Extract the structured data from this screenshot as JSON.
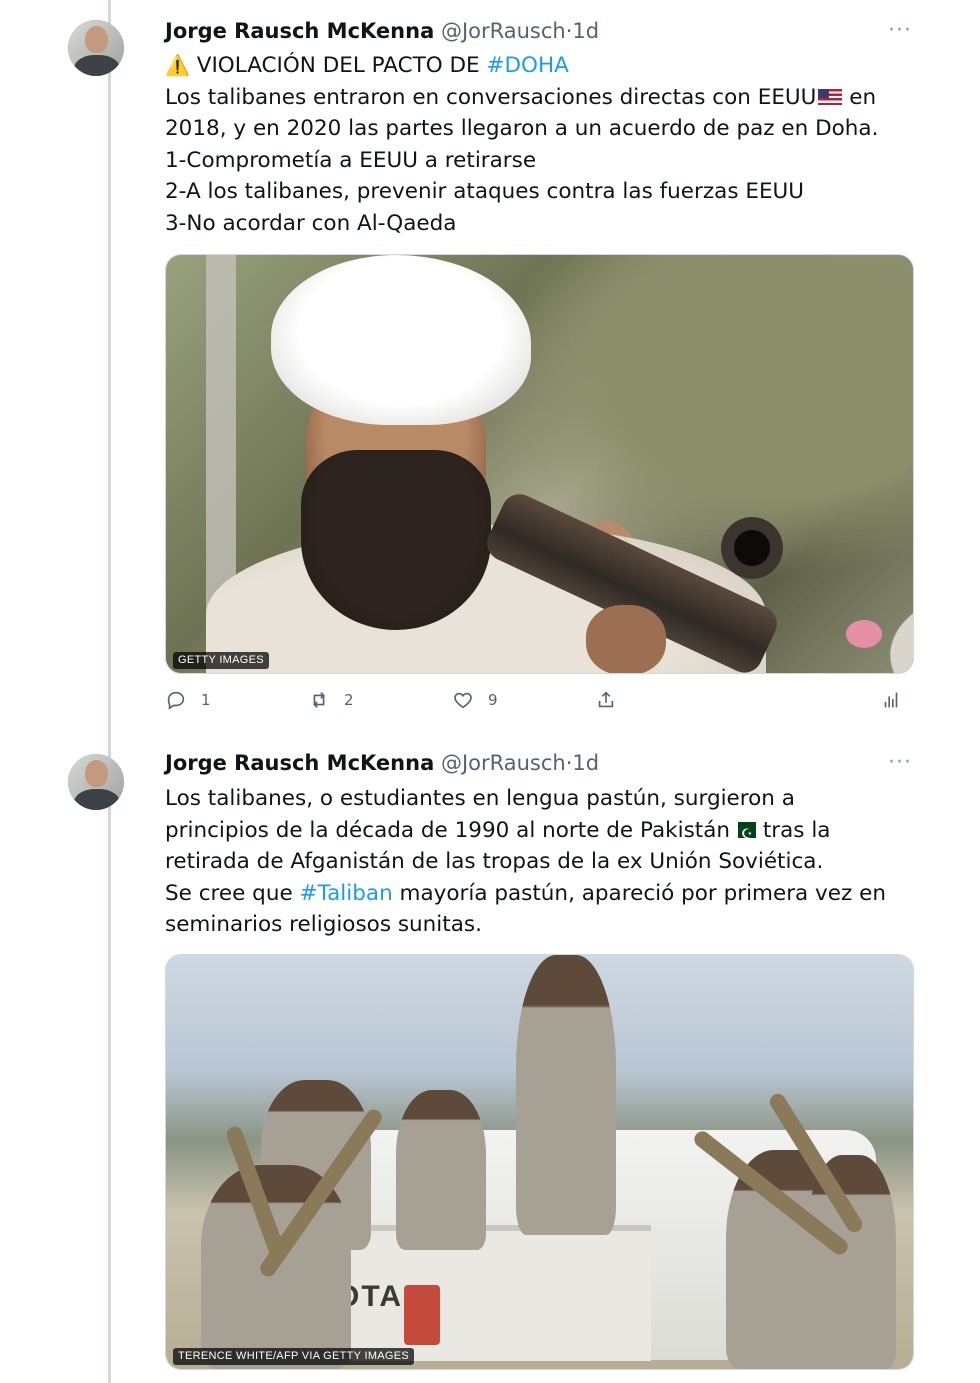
{
  "tweets": [
    {
      "author_name": "Jorge Rausch McKenna",
      "handle": "@JorRausch",
      "separator": "·",
      "time": "1d",
      "more_icon": "more-horizontal-icon",
      "lines": {
        "warning_emoji": "⚠️",
        "headline_text": "VIOLACIÓN DEL PACTO DE ",
        "headline_hashtag": "#DOHA",
        "l2a": "Los talibanes entraron en conversaciones directas con EEUU",
        "l2b": " en",
        "l3": "2018, y en 2020 las partes llegaron a un acuerdo de paz en Doha.",
        "l4": "1-Comprometía a EEUU a retirarse",
        "l5": "2-A los talibanes, prevenir ataques contra las fuerzas EEUU",
        "l6": "3-No acordar con Al-Qaeda"
      },
      "media_credit": "GETTY IMAGES",
      "stats": {
        "replies": "1",
        "retweets": "2",
        "likes": "9"
      }
    },
    {
      "author_name": "Jorge Rausch McKenna",
      "handle": "@JorRausch",
      "separator": "·",
      "time": "1d",
      "more_icon": "more-horizontal-icon",
      "lines": {
        "l1": "Los talibanes, o estudiantes en lengua pastún, surgieron a",
        "l2a": "principios de la década de 1990 al norte de Pakistán",
        "l2b": " tras la",
        "l3": "retirada de Afganistán de las tropas de la ex Unión Soviética.",
        "l4a": "Se cree que ",
        "l4_hashtag": "#Taliban",
        "l4b": " mayoría pastún, apareció por primera vez en",
        "l5": "seminarios religiosos sunitas."
      },
      "media_credit": "TERENCE WHITE/AFP VIA GETTY IMAGES",
      "truck_text": "OTA"
    }
  ],
  "colors": {
    "accent": "#1d9bf0",
    "secondary_text": "#536471",
    "thread_line": "#cfd9de"
  }
}
